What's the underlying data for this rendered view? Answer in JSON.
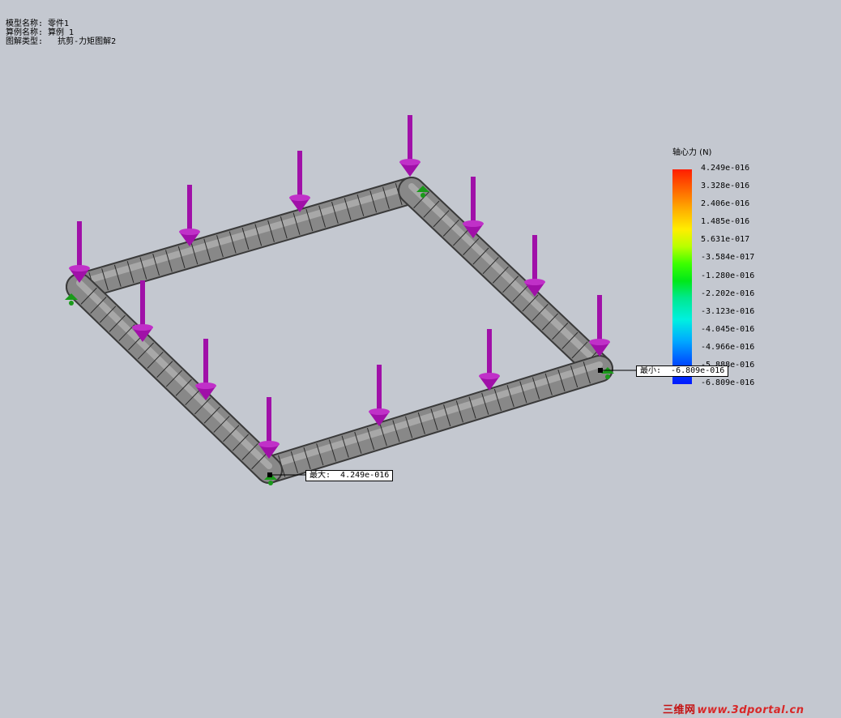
{
  "info": {
    "model_name": "模型名称: 零件1",
    "study_name": "算例名称: 算例 1",
    "plot_type": "图解类型:   抗剪-力矩图解2"
  },
  "legend": {
    "title": "轴心力 (N)",
    "labels": [
      "4.249e-016",
      "3.328e-016",
      "2.406e-016",
      "1.485e-016",
      "5.631e-017",
      "-3.584e-017",
      "-1.280e-016",
      "-2.202e-016",
      "-3.123e-016",
      "-4.045e-016",
      "-4.966e-016",
      "-5.888e-016",
      "-6.809e-016"
    ]
  },
  "max_tag": "最大:  4.249e-016",
  "min_tag": "最小:  -6.809e-016",
  "watermark": {
    "cn": "三维网",
    "url": "www.3dportal.cn"
  },
  "colors": {
    "background": "#c4c8d0",
    "beam": "#888888",
    "load_arrow": "#a010a8",
    "fixture": "#1a9a1a"
  }
}
